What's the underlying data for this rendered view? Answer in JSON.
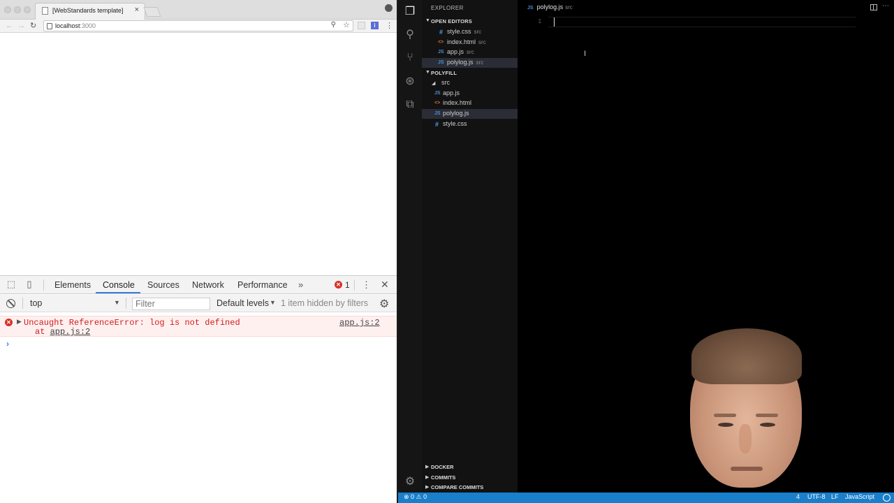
{
  "browser": {
    "tab_title": "[WebStandards template]",
    "tab_close": "×",
    "url_host": "localhost",
    "url_port": ":3000",
    "icons": {
      "back": "arrow-left-icon",
      "forward": "arrow-right-icon",
      "reload": "reload-icon",
      "zoom": "magnifier-icon",
      "bookmark": "star-icon",
      "menu": "kebab-icon",
      "profile": "person-icon"
    }
  },
  "devtools": {
    "tabs": [
      "Elements",
      "Console",
      "Sources",
      "Network",
      "Performance"
    ],
    "active_tab": "Console",
    "more_tabs": "»",
    "error_count": "1",
    "context": "top",
    "filter_placeholder": "Filter",
    "levels": "Default levels",
    "hidden_note": "1 item hidden by filters",
    "error": {
      "message": "Uncaught ReferenceError: log is not defined",
      "at_prefix": "at ",
      "at_link": "app.js:2",
      "source": "app.js:2"
    },
    "prompt": "›",
    "error_color": "#d01c1c",
    "accent": "#3b7de0"
  },
  "vscode": {
    "explorer_title": "EXPLORER",
    "open_editors_label": "OPEN EDITORS",
    "open_editors": [
      {
        "icon": "#",
        "name": "style.css",
        "dir": "src",
        "type": "css"
      },
      {
        "icon": "<>",
        "name": "index.html",
        "dir": "src",
        "type": "html"
      },
      {
        "icon": "JS",
        "name": "app.js",
        "dir": "src",
        "type": "js"
      },
      {
        "icon": "JS",
        "name": "polylog.js",
        "dir": "src",
        "type": "js"
      }
    ],
    "project_label": "POLYFILL",
    "folder": "src",
    "files": [
      {
        "icon": "JS",
        "name": "app.js",
        "type": "js"
      },
      {
        "icon": "<>",
        "name": "index.html",
        "type": "html"
      },
      {
        "icon": "JS",
        "name": "polylog.js",
        "type": "js"
      },
      {
        "icon": "#",
        "name": "style.css",
        "type": "css"
      }
    ],
    "editor_tab": {
      "icon": "JS",
      "name": "polylog.js",
      "dir": "src"
    },
    "line_number": "1",
    "bottom_sections": [
      "DOCKER",
      "COMMITS",
      "COMPARE COMMITS"
    ],
    "status": {
      "problems": "⊗ 0 ⚠ 0",
      "indent_tail": "4",
      "encoding": "UTF-8",
      "eol": "LF",
      "language": "JavaScript"
    },
    "status_color": "#1a7fcb"
  }
}
